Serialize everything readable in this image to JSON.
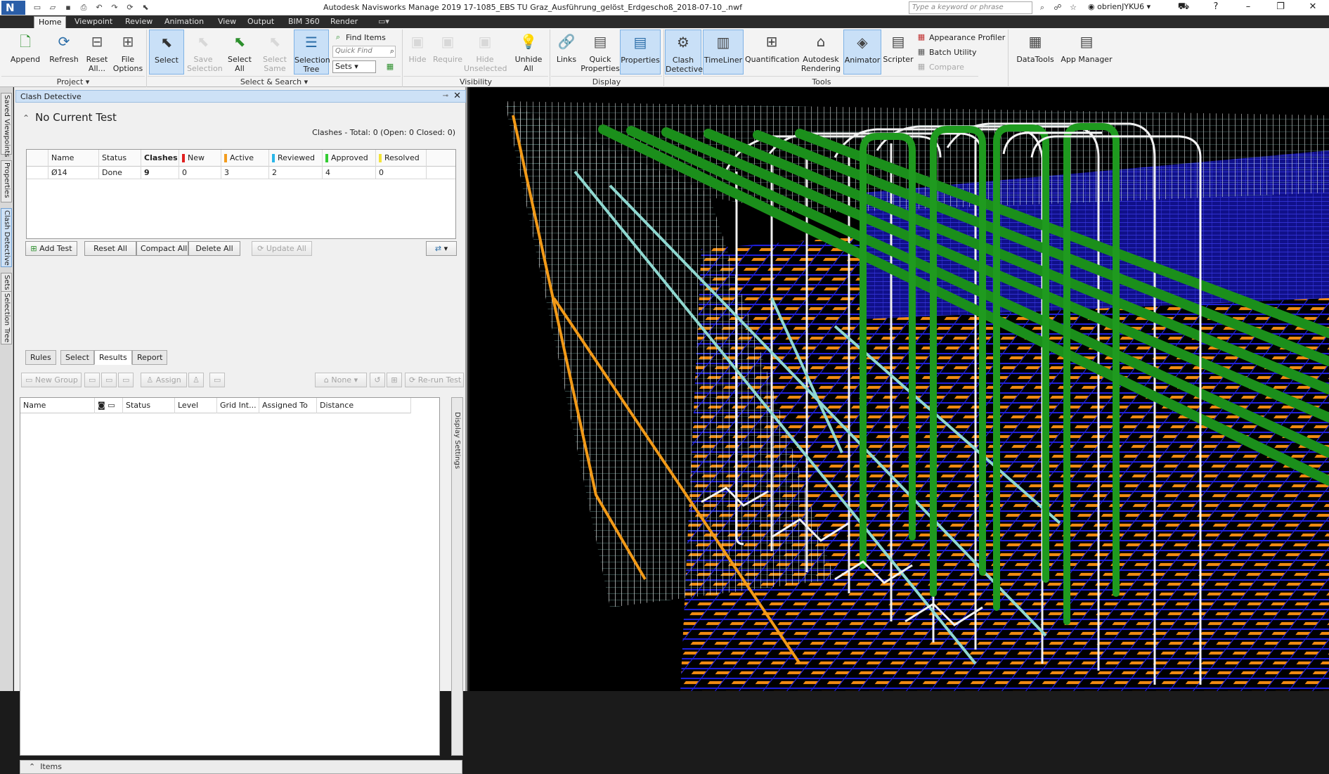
{
  "app": {
    "logo": "N",
    "title": "Autodesk Navisworks Manage 2019    17-1085_EBS TU Graz_Ausführung_gelöst_Erdgeschoß_2018-07-10_.nwf",
    "search_placeholder": "Type a keyword or phrase",
    "user": "obrienJYKU6"
  },
  "tabs": [
    "Home",
    "Viewpoint",
    "Review",
    "Animation",
    "View",
    "Output",
    "BIM 360",
    "Render"
  ],
  "ribbon": {
    "append": "Append",
    "refresh": "Refresh",
    "reset_all": "Reset All...",
    "file_options": "File Options",
    "select": "Select",
    "save_selection": "Save Selection",
    "select_all": "Select All",
    "select_same": "Select Same",
    "selection_tree": "Selection Tree",
    "find_items": "Find Items",
    "quick_find_placeholder": "Quick Find",
    "sets": "Sets",
    "hide": "Hide",
    "require": "Require",
    "hide_unselected": "Hide Unselected",
    "unhide_all": "Unhide All",
    "links": "Links",
    "quick_properties": "Quick Properties",
    "properties": "Properties",
    "clash_detective": "Clash Detective",
    "timeliner": "TimeLiner",
    "quantification": "Quantification",
    "autodesk_rendering": "Autodesk Rendering",
    "animator": "Animator",
    "scripter": "Scripter",
    "appearance_profiler": "Appearance Profiler",
    "batch_utility": "Batch Utility",
    "compare": "Compare",
    "datatools": "DataTools",
    "app_manager": "App Manager",
    "groups": {
      "project": "Project",
      "select_search": "Select & Search",
      "visibility": "Visibility",
      "display": "Display",
      "tools": "Tools"
    }
  },
  "side_tabs": [
    "Saved Viewpoints",
    "Properties",
    "Clash Detective",
    "Sets",
    "Selection Tree"
  ],
  "panel": {
    "title": "Clash Detective",
    "current_test": "No Current Test",
    "summary": "Clashes - Total:  0  (Open:  0  Closed:  0)",
    "columns": [
      "Name",
      "Status",
      "Clashes",
      "New",
      "Active",
      "Reviewed",
      "Approved",
      "Resolved"
    ],
    "column_colors": {
      "New": "#e02020",
      "Active": "#f39c1e",
      "Reviewed": "#2ab6e8",
      "Approved": "#33cc33",
      "Resolved": "#f2e33a"
    },
    "test_row": {
      "name": "Ø14",
      "status": "Done",
      "clashes": "9",
      "new": "0",
      "active": "3",
      "reviewed": "2",
      "approved": "4",
      "resolved": "0"
    },
    "buttons": {
      "add_test": "Add Test",
      "reset_all": "Reset All",
      "compact_all": "Compact All",
      "delete_all": "Delete All",
      "update_all": "Update All"
    },
    "subtabs": [
      "Rules",
      "Select",
      "Results",
      "Report"
    ],
    "results_toolbar": {
      "new_group": "New Group",
      "assign": "Assign",
      "none": "None",
      "rerun": "Re-run Test"
    },
    "results_columns": [
      "Name",
      "Status",
      "Level",
      "Grid Int...",
      "Assigned To",
      "Distance"
    ],
    "display_settings": "Display Settings",
    "items": "Items"
  }
}
